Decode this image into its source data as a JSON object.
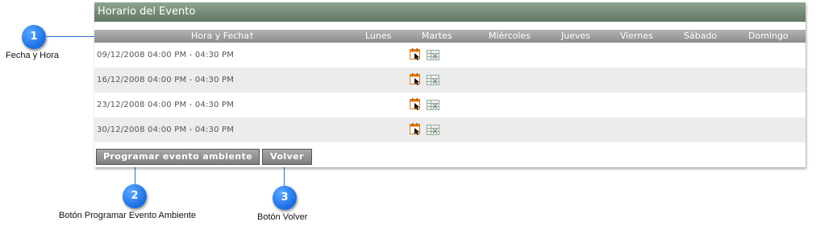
{
  "panel": {
    "title": "Horario del Evento"
  },
  "table": {
    "columns": {
      "datetime": "Hora y Fecha†",
      "mon": "Lunes",
      "tue": "Martes",
      "wed": "Miércoles",
      "thu": "Jueves",
      "fri": "Viernes",
      "sat": "Sábado",
      "sun": "Domingo"
    },
    "rows": [
      {
        "datetime": "09/12/2008 04:00 PM - 04:30 PM"
      },
      {
        "datetime": "16/12/2008 04:00 PM - 04:30 PM"
      },
      {
        "datetime": "23/12/2008 04:00 PM - 04:30 PM"
      },
      {
        "datetime": "30/12/2008 04:00 PM - 04:30 PM"
      }
    ],
    "row_icons": [
      "calendar-edit-icon",
      "grid-delete-icon"
    ]
  },
  "buttons": {
    "ambient": "Programar evento ambiente",
    "back": "Volver"
  },
  "callouts": [
    {
      "number": "1",
      "label": "Fecha y Hora"
    },
    {
      "number": "2",
      "label": "Botón Programar Evento Ambiente"
    },
    {
      "number": "3",
      "label": "Botón Volver"
    }
  ],
  "colors": {
    "title_bar": "#6f8673",
    "header": "#9e9e9e",
    "callout": "#1f6fe6"
  }
}
